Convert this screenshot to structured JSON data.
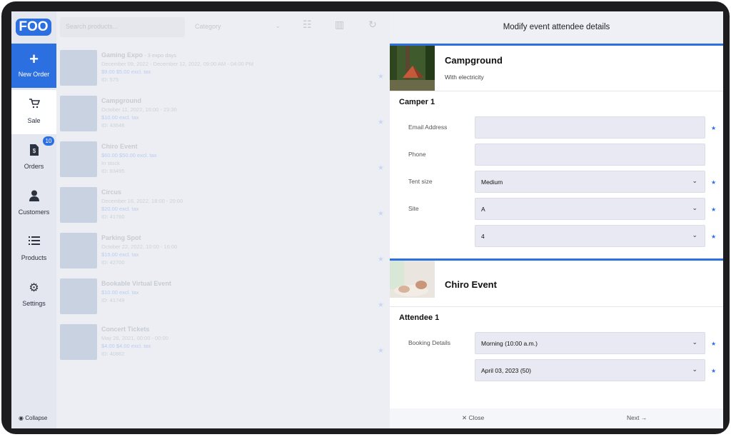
{
  "app": {
    "logo": "FOO"
  },
  "sidebar": {
    "new_order": {
      "label": "New Order",
      "icon": "+"
    },
    "sale": {
      "label": "Sale",
      "icon": "🛒"
    },
    "orders": {
      "label": "Orders",
      "icon": "$",
      "badge": "10"
    },
    "customers": {
      "label": "Customers",
      "icon": "👤"
    },
    "products": {
      "label": "Products",
      "icon": "☰"
    },
    "settings": {
      "label": "Settings",
      "icon": "⚙"
    },
    "collapse": "Collapse"
  },
  "toolbar": {
    "search_placeholder": "Search products...",
    "category": "Category"
  },
  "products": [
    {
      "name": "Gaming Expo",
      "name_suffix": " - 3 expo days",
      "line1": "December 09, 2022 - December 12, 2022, 09:00 AM - 04:00 PM",
      "line2": "$9.00 $5.00 excl. tax",
      "line3": "ID: 575"
    },
    {
      "name": "Campground",
      "line1": "October 11, 2022, 16:00 - 23:30",
      "line2": "$10.00 excl. tax",
      "line3": "ID: 43646"
    },
    {
      "name": "Chiro Event",
      "line1": "$60.00 $50.00 excl. tax",
      "line2": "In stock",
      "line3": "ID: 93495"
    },
    {
      "name": "Circus",
      "line1": "December 16, 2022, 18:00 - 20:00",
      "line2": "$20.00 excl. tax",
      "line3": "ID: 41760"
    },
    {
      "name": "Parking Spot",
      "line1": "October 22, 2022, 10:00 - 16:00",
      "line2": "$15.00 excl. tax",
      "line3": "ID: 42700"
    },
    {
      "name": "Bookable Virtual Event",
      "line1": "$10.00 excl. tax",
      "line2": "ID: 41749",
      "line3": ""
    },
    {
      "name": "Concert Tickets",
      "line1": "May 26, 2021, 00:00 - 00:00",
      "line2": "$4.00 $4.00 excl. tax",
      "line3": "ID: 40862"
    }
  ],
  "modal": {
    "title": "Modify event attendee details",
    "section1": {
      "title": "Campground",
      "subtitle": "With electricity",
      "group": "Camper 1",
      "fields": [
        {
          "label": "Email Address",
          "value": ""
        },
        {
          "label": "Phone",
          "value": ""
        },
        {
          "label": "Tent size",
          "value": "Medium"
        },
        {
          "label": "Site",
          "value": "A"
        },
        {
          "label": "",
          "value": "4"
        }
      ]
    },
    "section2": {
      "title": "Chiro Event",
      "group": "Attendee 1",
      "fields": [
        {
          "label": "Booking Details",
          "value": "Morning (10:00 a.m.)"
        },
        {
          "label": "",
          "value": "April 03, 2023 (50)"
        }
      ]
    },
    "close_label": "✕ Close",
    "next_label": "Next →",
    "required_mark": "★"
  },
  "colors": {
    "accent": "#2c6fe0",
    "sidebar_bg": "#e4e7ef"
  }
}
